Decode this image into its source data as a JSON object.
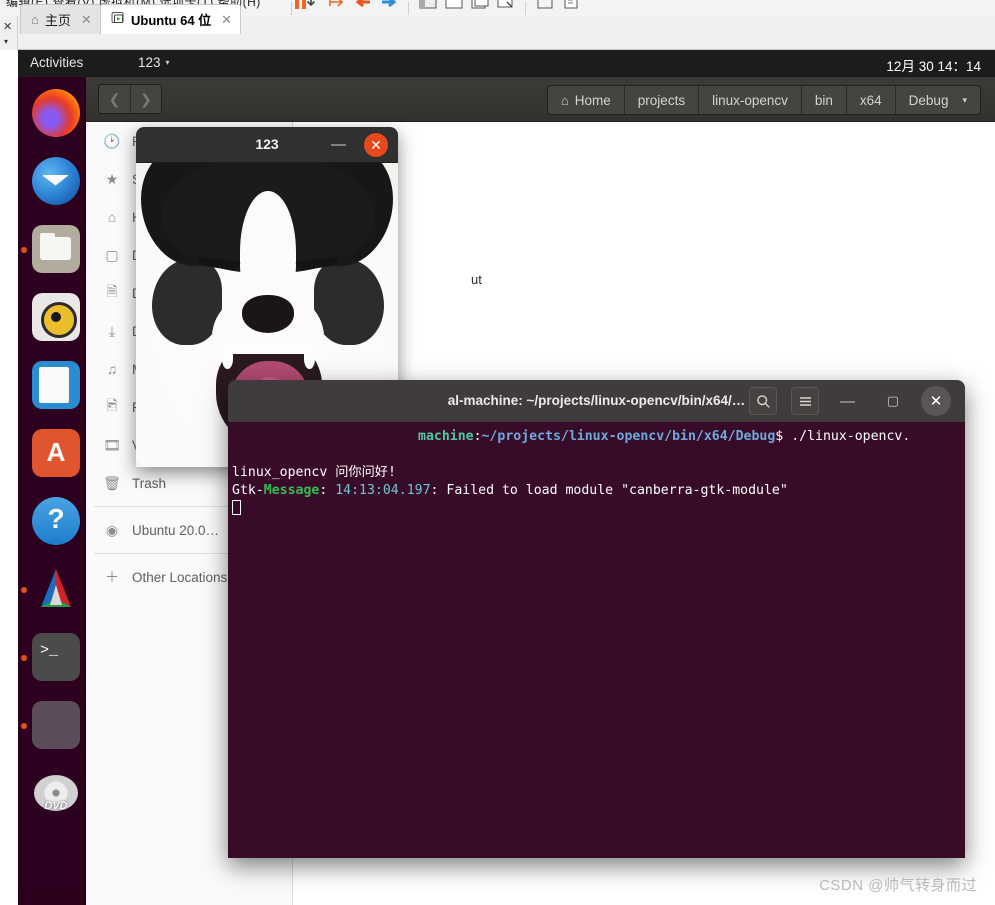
{
  "vmware": {
    "menubar_text": "编辑(E)  查看(V)  虚拟机(M)  选项卡(T)  帮助(H)",
    "tabs": [
      {
        "label": "主页",
        "icon": "home-icon",
        "active": false,
        "close": "✕"
      },
      {
        "label": "Ubuntu 64 位",
        "icon": "vm-icon",
        "active": true,
        "close": "✕"
      }
    ],
    "side_close": "✕",
    "side_chevron": "▾"
  },
  "gnome": {
    "activities": "Activities",
    "app_name": "123",
    "app_caret": "▾",
    "clock": "12月 30  14：14"
  },
  "dock": {
    "items": [
      {
        "name": "firefox",
        "label": "Firefox",
        "running": false
      },
      {
        "name": "thunderbird",
        "label": "Thunderbird Mail",
        "running": false
      },
      {
        "name": "files",
        "label": "Files",
        "running": true
      },
      {
        "name": "rhythmbox",
        "label": "Rhythmbox",
        "running": false
      },
      {
        "name": "libreoffice-writer",
        "label": "LibreOffice Writer",
        "running": false
      },
      {
        "name": "ubuntu-software",
        "label": "Ubuntu Software",
        "running": false
      },
      {
        "name": "help",
        "label": "Help",
        "running": false
      },
      {
        "name": "image-viewer",
        "label": "Image Viewer",
        "running": true
      },
      {
        "name": "terminal",
        "label": "Terminal",
        "running": true
      },
      {
        "name": "blank-window",
        "label": "Window",
        "running": true
      },
      {
        "name": "dvd",
        "label": "DVD",
        "running": false,
        "caption": "DVD"
      }
    ]
  },
  "files_window": {
    "nav": {
      "back": "❮",
      "forward": "❯"
    },
    "breadcrumbs": [
      {
        "label": "Home",
        "icon": "home-icon"
      },
      {
        "label": "projects",
        "icon": ""
      },
      {
        "label": "linux-opencv",
        "icon": ""
      },
      {
        "label": "bin",
        "icon": ""
      },
      {
        "label": "x64",
        "icon": ""
      },
      {
        "label": "Debug",
        "icon": "",
        "caret": "▾"
      }
    ],
    "sidebar": [
      {
        "label": "Recent",
        "icon": "clock-icon"
      },
      {
        "label": "Starred",
        "icon": "star-icon"
      },
      {
        "label": "Home",
        "icon": "home-icon"
      },
      {
        "label": "Desktop",
        "icon": "desktop-icon"
      },
      {
        "label": "Documents",
        "icon": "documents-icon"
      },
      {
        "label": "Downloads",
        "icon": "download-icon"
      },
      {
        "label": "Music",
        "icon": "music-icon"
      },
      {
        "label": "Pictures",
        "icon": "pictures-icon"
      },
      {
        "label": "Videos",
        "icon": "video-icon"
      },
      {
        "label": "Trash",
        "icon": "trash-icon"
      },
      {
        "label": "Ubuntu 20.0…",
        "icon": "disc-icon"
      },
      {
        "label": "Other Locations",
        "icon": "plus-icon"
      }
    ],
    "content_fragment": "ut"
  },
  "image_viewer": {
    "title": "123",
    "minimize": "—",
    "close": "✕",
    "image_alt": "smiling husky dog"
  },
  "terminal": {
    "title": "al-machine: ~/projects/linux-opencv/bin/x64/…",
    "search_icon": "🔍",
    "menu_icon": "☰",
    "minimize": "—",
    "maximize": "▢",
    "close": "✕",
    "lines": [
      {
        "type": "prompt",
        "host": "machine",
        "separator": ":",
        "path": "~/projects/linux-opencv/bin/x64/Debug",
        "dollar": "$",
        "command": " ./linux-opencv."
      },
      {
        "type": "output",
        "text": "linux_opencv 问你问好!"
      },
      {
        "type": "gtk",
        "tag": "Gtk-",
        "level": "Message",
        "colon": ": ",
        "time": "14:13:04.197",
        "rest": ": Failed to load module \"canberra-gtk-module\""
      }
    ]
  },
  "watermark": "CSDN @帅气转身而过",
  "colors": {
    "ubuntu_purple": "#2c001e",
    "terminal_bg": "#380c29",
    "accent_orange": "#e95420",
    "close_red": "#e8491c",
    "header_gray": "#3c3b37"
  }
}
